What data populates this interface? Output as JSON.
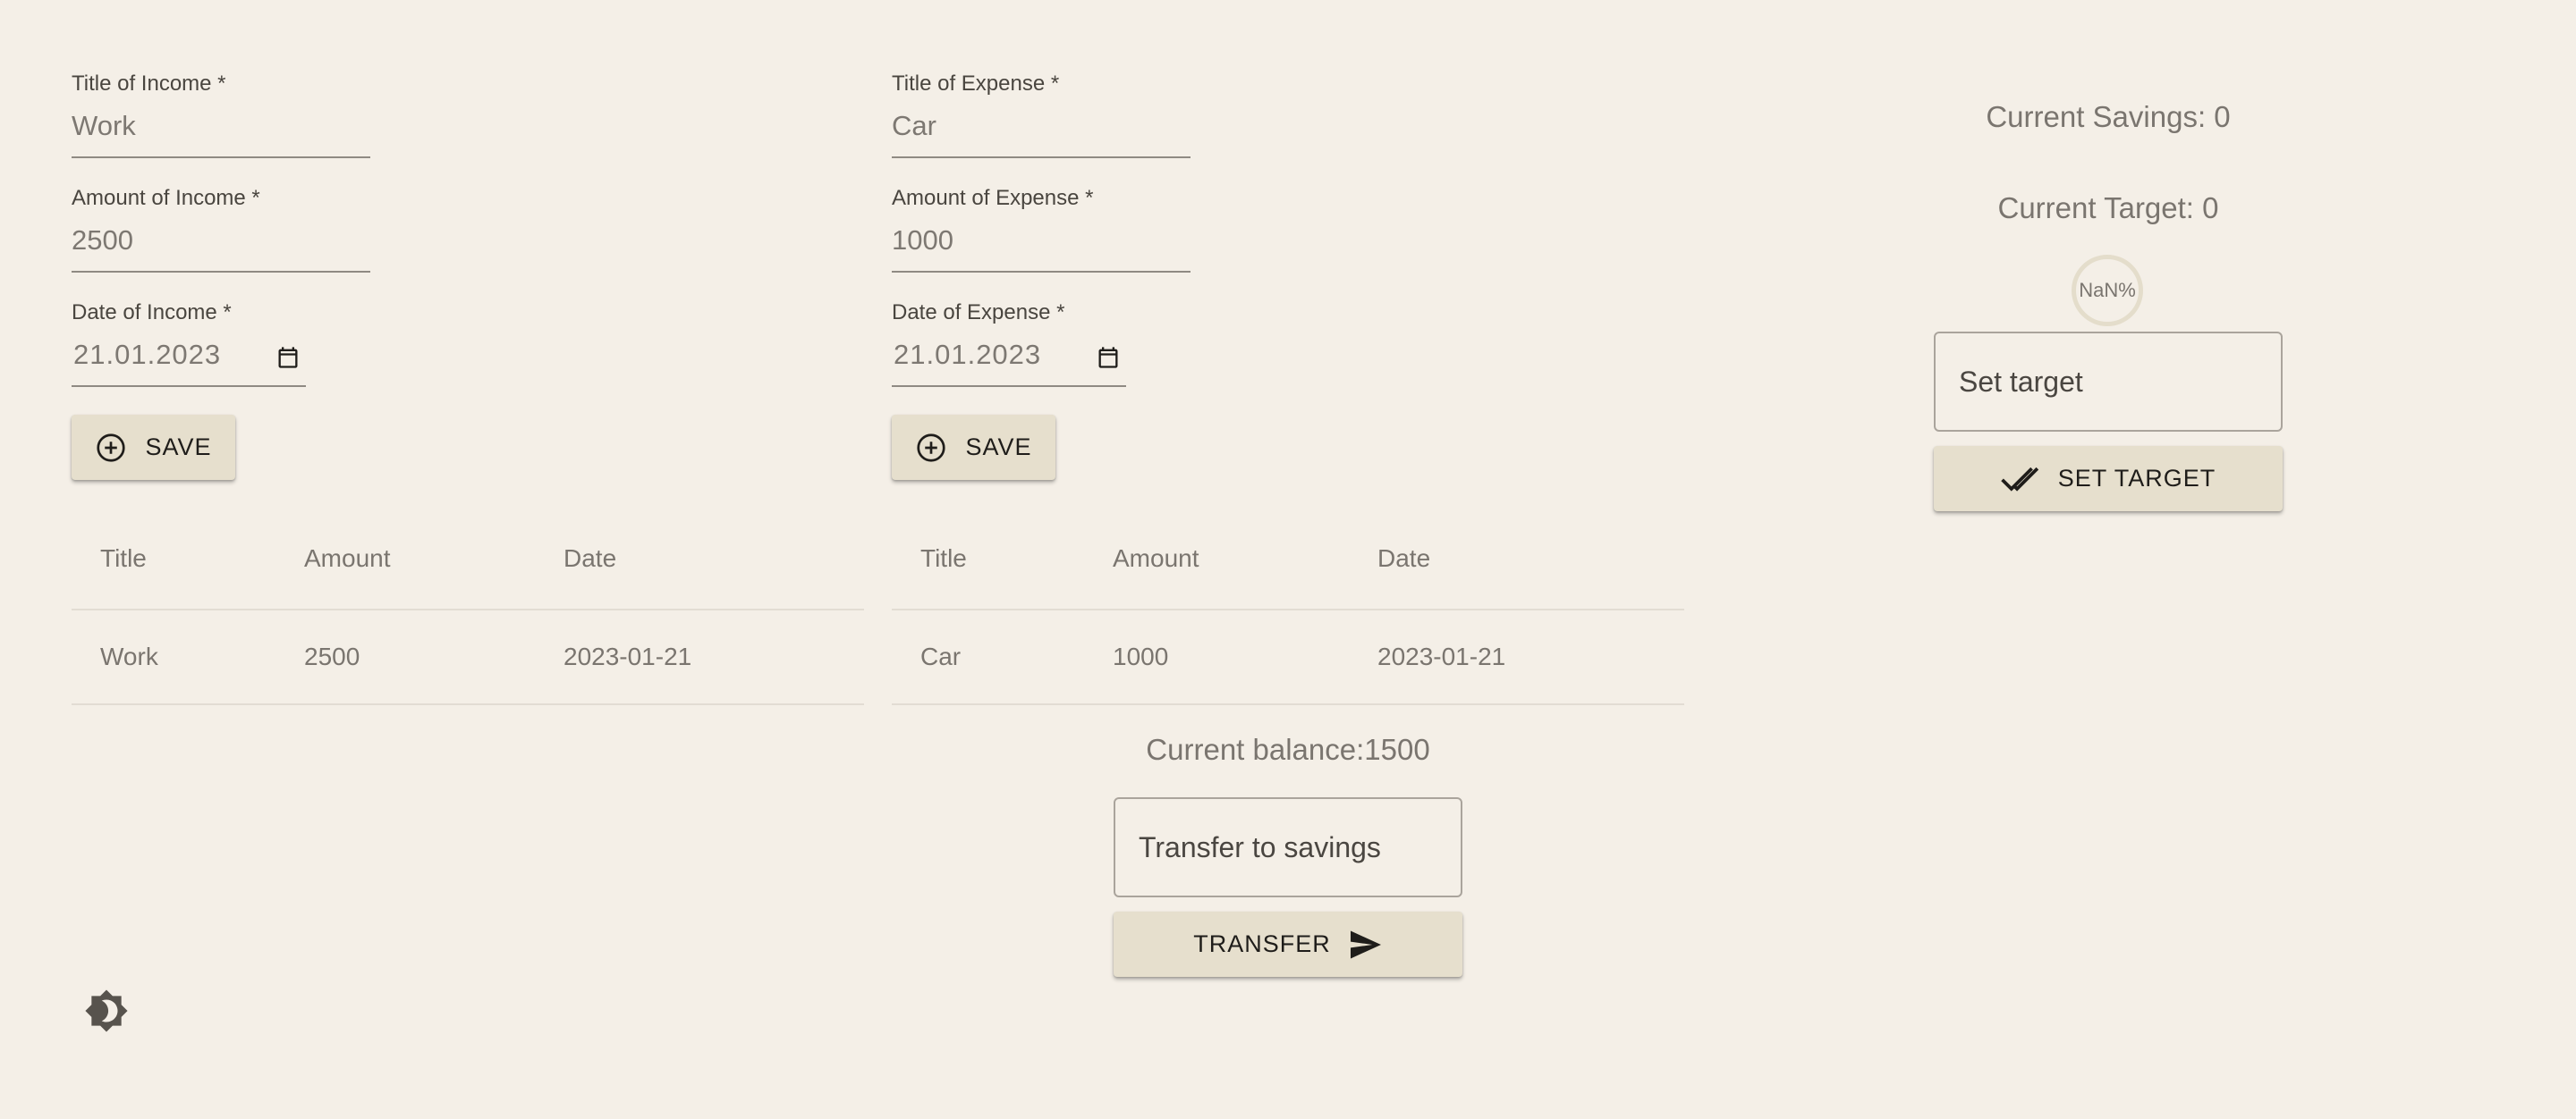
{
  "income": {
    "title_label": "Title of Income *",
    "title_value": "Work",
    "amount_label": "Amount of Income *",
    "amount_value": "2500",
    "date_label": "Date of Income *",
    "date_value": "21.01.2023",
    "save_label": "SAVE",
    "table": {
      "headers": [
        "Title",
        "Amount",
        "Date"
      ],
      "rows": [
        [
          "Work",
          "2500",
          "2023-01-21"
        ]
      ]
    }
  },
  "expense": {
    "title_label": "Title of Expense *",
    "title_value": "Car",
    "amount_label": "Amount of Expense *",
    "amount_value": "1000",
    "date_label": "Date of Expense *",
    "date_value": "21.01.2023",
    "save_label": "SAVE",
    "table": {
      "headers": [
        "Title",
        "Amount",
        "Date"
      ],
      "rows": [
        [
          "Car",
          "1000",
          "2023-01-21"
        ]
      ]
    }
  },
  "balance": {
    "text": "Current balance:1500",
    "transfer_placeholder": "Transfer to savings",
    "transfer_label": "TRANSFER"
  },
  "savings": {
    "current_savings": "Current Savings: 0",
    "current_target": "Current Target: 0",
    "progress": "NaN%",
    "target_placeholder": "Set target",
    "set_target_label": "SET TARGET"
  },
  "icons": {
    "save": "add-circle-outline-icon",
    "calendar": "calendar-icon",
    "set_target": "done-all-icon",
    "transfer": "send-icon",
    "theme": "brightness-toggle-icon"
  },
  "colors": {
    "background": "#f4efe7",
    "button": "#e6dfcd",
    "text_muted": "#7a756f"
  }
}
